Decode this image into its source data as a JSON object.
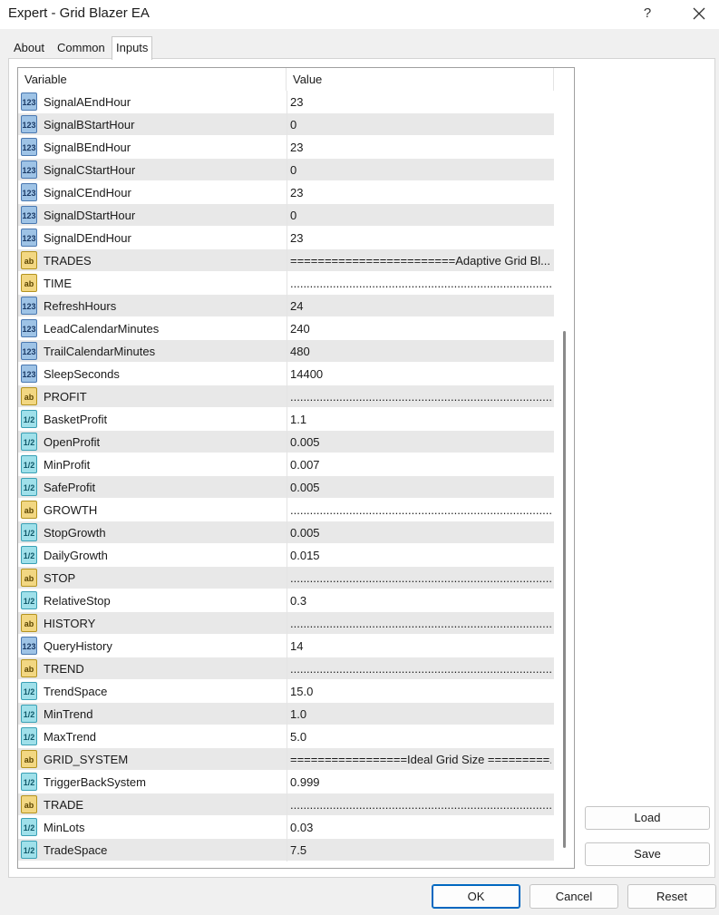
{
  "window": {
    "title": "Expert - Grid Blazer EA",
    "help_glyph": "?"
  },
  "tabs": [
    {
      "label": "About"
    },
    {
      "label": "Common"
    },
    {
      "label": "Inputs",
      "active": true
    }
  ],
  "grid": {
    "columns": {
      "variable": "Variable",
      "value": "Value"
    },
    "rows": [
      {
        "type": "int",
        "icon_text": "123",
        "name": "SignalAEndHour",
        "value": "23"
      },
      {
        "type": "int",
        "icon_text": "123",
        "name": "SignalBStartHour",
        "value": "0"
      },
      {
        "type": "int",
        "icon_text": "123",
        "name": "SignalBEndHour",
        "value": "23"
      },
      {
        "type": "int",
        "icon_text": "123",
        "name": "SignalCStartHour",
        "value": "0"
      },
      {
        "type": "int",
        "icon_text": "123",
        "name": "SignalCEndHour",
        "value": "23"
      },
      {
        "type": "int",
        "icon_text": "123",
        "name": "SignalDStartHour",
        "value": "0"
      },
      {
        "type": "int",
        "icon_text": "123",
        "name": "SignalDEndHour",
        "value": "23"
      },
      {
        "type": "str",
        "icon_text": "ab",
        "name": "TRADES",
        "value": "========================Adaptive Grid Bl..."
      },
      {
        "type": "str",
        "icon_text": "ab",
        "name": "TIME",
        "value": "............................................................................................"
      },
      {
        "type": "int",
        "icon_text": "123",
        "name": "RefreshHours",
        "value": "24"
      },
      {
        "type": "int",
        "icon_text": "123",
        "name": "LeadCalendarMinutes",
        "value": "240"
      },
      {
        "type": "int",
        "icon_text": "123",
        "name": "TrailCalendarMinutes",
        "value": "480"
      },
      {
        "type": "int",
        "icon_text": "123",
        "name": "SleepSeconds",
        "value": "14400"
      },
      {
        "type": "str",
        "icon_text": "ab",
        "name": "PROFIT",
        "value": "............................................................................................"
      },
      {
        "type": "dbl",
        "icon_text": "1/2",
        "name": "BasketProfit",
        "value": "1.1"
      },
      {
        "type": "dbl",
        "icon_text": "1/2",
        "name": "OpenProfit",
        "value": "0.005"
      },
      {
        "type": "dbl",
        "icon_text": "1/2",
        "name": "MinProfit",
        "value": "0.007"
      },
      {
        "type": "dbl",
        "icon_text": "1/2",
        "name": "SafeProfit",
        "value": "0.005"
      },
      {
        "type": "str",
        "icon_text": "ab",
        "name": "GROWTH",
        "value": "............................................................................................"
      },
      {
        "type": "dbl",
        "icon_text": "1/2",
        "name": "StopGrowth",
        "value": "0.005"
      },
      {
        "type": "dbl",
        "icon_text": "1/2",
        "name": "DailyGrowth",
        "value": "0.015"
      },
      {
        "type": "str",
        "icon_text": "ab",
        "name": "STOP",
        "value": "............................................................................................"
      },
      {
        "type": "dbl",
        "icon_text": "1/2",
        "name": "RelativeStop",
        "value": "0.3"
      },
      {
        "type": "str",
        "icon_text": "ab",
        "name": "HISTORY",
        "value": "............................................................................................"
      },
      {
        "type": "int",
        "icon_text": "123",
        "name": "QueryHistory",
        "value": "14"
      },
      {
        "type": "str",
        "icon_text": "ab",
        "name": "TREND",
        "value": "............................................................................................"
      },
      {
        "type": "dbl",
        "icon_text": "1/2",
        "name": "TrendSpace",
        "value": "15.0"
      },
      {
        "type": "dbl",
        "icon_text": "1/2",
        "name": "MinTrend",
        "value": "1.0"
      },
      {
        "type": "dbl",
        "icon_text": "1/2",
        "name": "MaxTrend",
        "value": "5.0"
      },
      {
        "type": "str",
        "icon_text": "ab",
        "name": "GRID_SYSTEM",
        "value": "=================Ideal Grid Size =========..."
      },
      {
        "type": "dbl",
        "icon_text": "1/2",
        "name": "TriggerBackSystem",
        "value": "0.999"
      },
      {
        "type": "str",
        "icon_text": "ab",
        "name": "TRADE",
        "value": "............................................................................................"
      },
      {
        "type": "dbl",
        "icon_text": "1/2",
        "name": "MinLots",
        "value": "0.03"
      },
      {
        "type": "dbl",
        "icon_text": "1/2",
        "name": "TradeSpace",
        "value": "7.5"
      }
    ]
  },
  "side_buttons": {
    "load": "Load",
    "save": "Save"
  },
  "bottom_buttons": {
    "ok": "OK",
    "cancel": "Cancel",
    "reset": "Reset"
  }
}
